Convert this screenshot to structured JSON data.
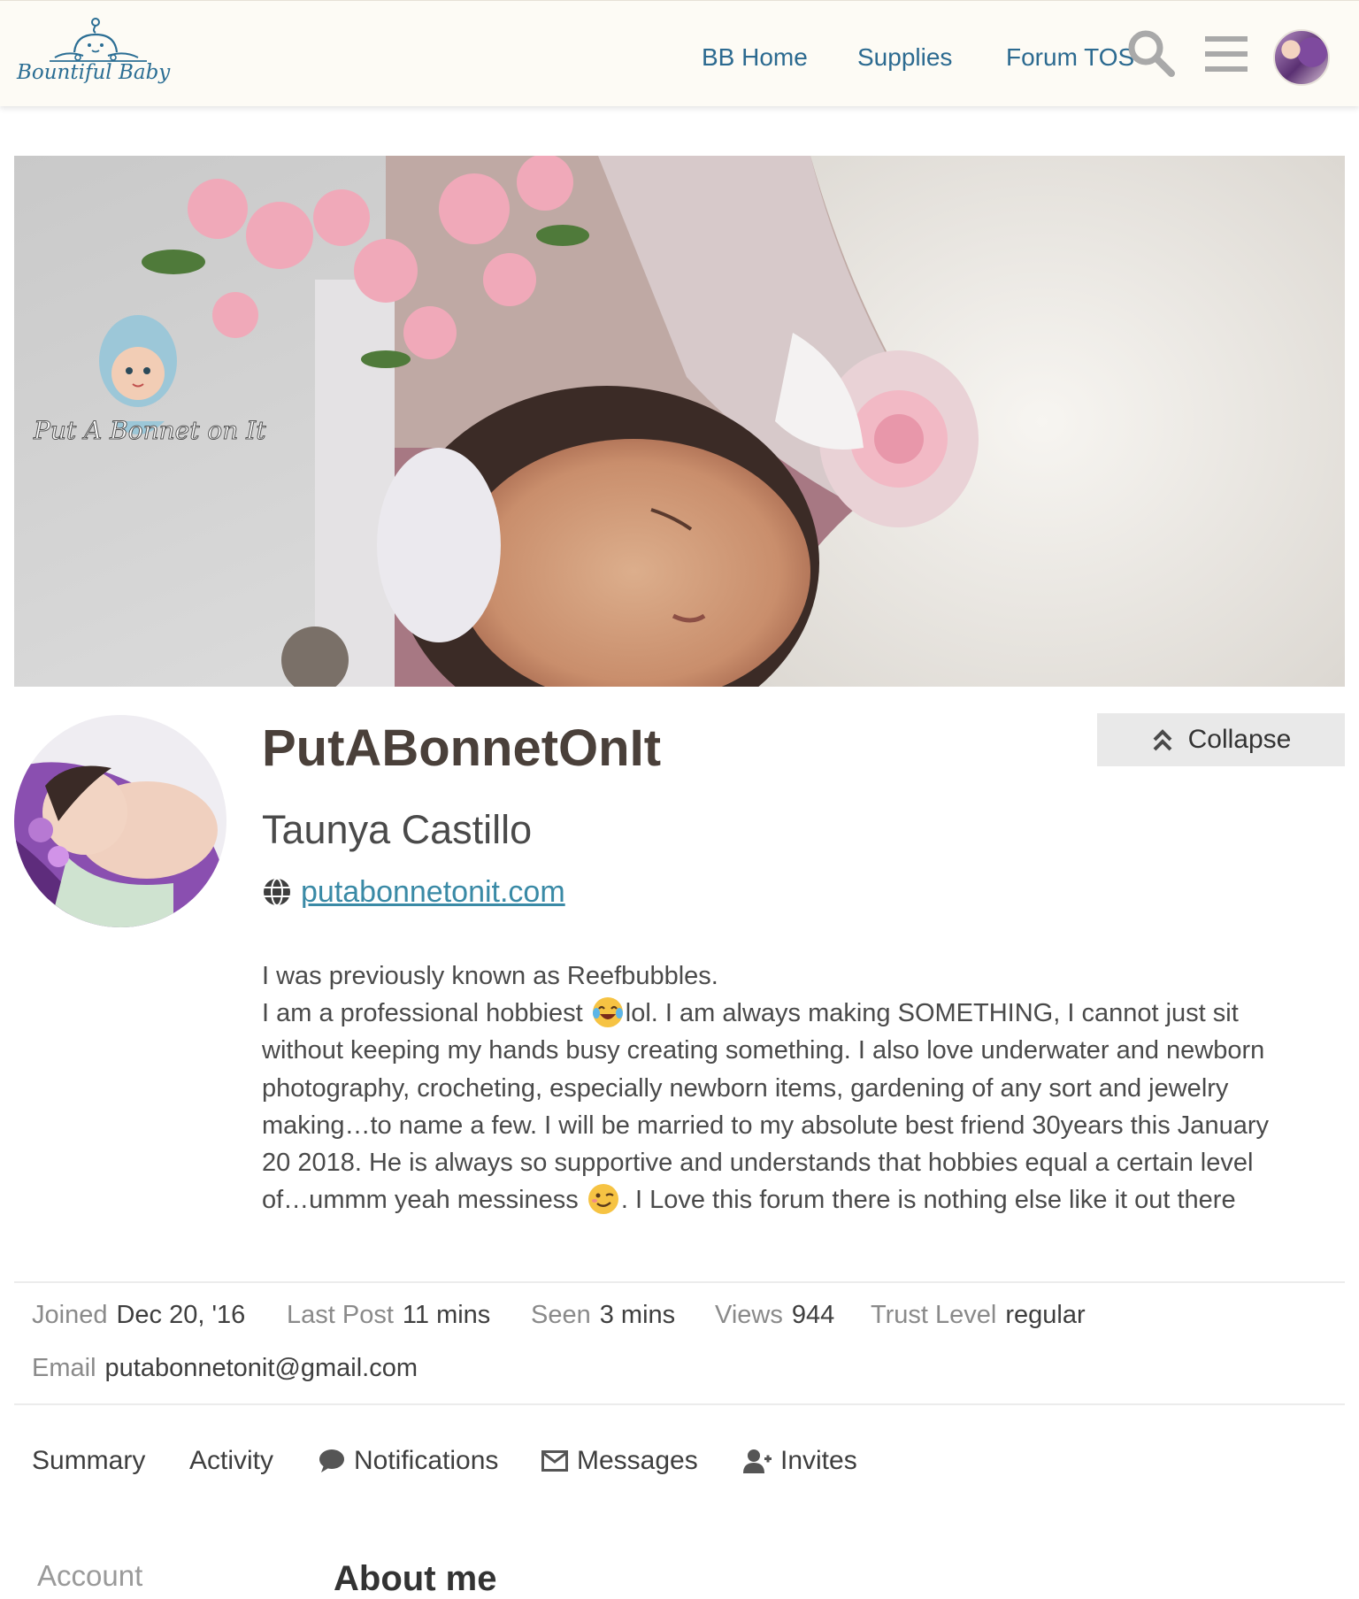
{
  "header": {
    "logo_text": "Bountiful Baby",
    "nav": [
      {
        "label": "BB Home"
      },
      {
        "label": "Supplies"
      },
      {
        "label": "Forum TOS"
      }
    ],
    "icons": [
      "search-icon",
      "hamburger-menu-icon",
      "user-avatar"
    ]
  },
  "banner": {
    "watermark_text": "Put A Bonnet on It"
  },
  "profile": {
    "username": "PutABonnetOnIt",
    "full_name": "Taunya Castillo",
    "website": "putabonnetonit.com",
    "collapse_label": "Collapse",
    "bio_lines": [
      "I was previously known as Reefbubbles.",
      "I am a professional hobbiest",
      "lol. I am always making SOMETHING, I cannot just sit",
      "without keeping my hands busy creating something. I also love underwater and newborn",
      "photography, crocheting, especially newborn items, gardening of any sort and jewelry",
      "making…to name a few. I will be married to my absolute best friend 30years this January",
      "20 2018. He is always so supportive and understands that hobbies equal a certain level",
      "of…ummm yeah messiness",
      ". I Love this forum there is nothing else like it out there"
    ],
    "bio_emojis": [
      "tears-of-joy-emoji",
      "winking-face-emoji"
    ]
  },
  "stats": {
    "joined_label": "Joined",
    "joined_value": "Dec 20, '16",
    "last_post_label": "Last Post",
    "last_post_value": "11 mins",
    "seen_label": "Seen",
    "seen_value": "3 mins",
    "views_label": "Views",
    "views_value": "944",
    "trust_label": "Trust Level",
    "trust_value": "regular",
    "email_label": "Email",
    "email_value": "putabonnetonit@gmail.com"
  },
  "tabs": [
    {
      "label": "Summary"
    },
    {
      "label": "Activity"
    },
    {
      "label": "Notifications"
    },
    {
      "label": "Messages"
    },
    {
      "label": "Invites"
    }
  ],
  "sidebar": {
    "account_label": "Account"
  },
  "main": {
    "section_heading": "About me"
  },
  "colors": {
    "link": "#2c6a90",
    "website_link": "#3a8aa6",
    "header_bg": "#fdfbf5",
    "collapse_bg": "#e9e9e9"
  }
}
